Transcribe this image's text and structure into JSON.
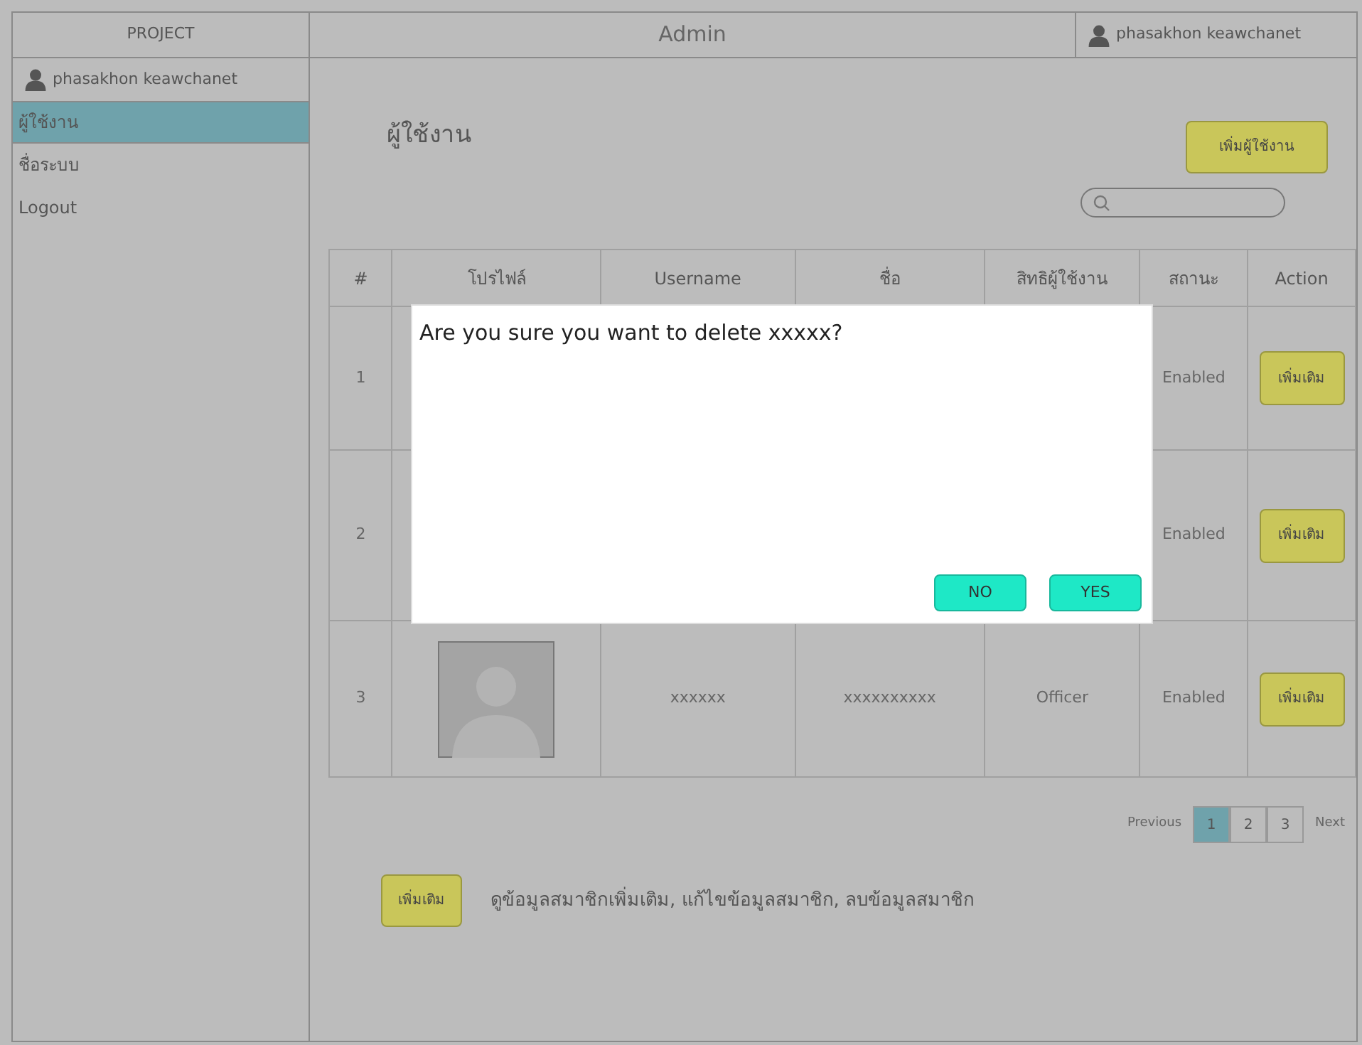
{
  "sidebar": {
    "brand": "PROJECT",
    "user": "phasakhon keawchanet",
    "items": [
      {
        "label": "ผู้ใช้งาน",
        "selected": true
      },
      {
        "label": "ชื่อระบบ",
        "selected": false
      },
      {
        "label": "Logout",
        "selected": false
      }
    ]
  },
  "header": {
    "title": "Admin",
    "user": "phasakhon keawchanet"
  },
  "page": {
    "title": "ผู้ใช้งาน",
    "add_button": "เพิ่มผู้ใช้งาน"
  },
  "table": {
    "columns": [
      "#",
      "โปรไฟล์",
      "Username",
      "ชื่อ",
      "สิทธิผู้ใช้งาน",
      "สถานะ",
      "Action"
    ],
    "rows": [
      {
        "number": "1",
        "status": "Enabled",
        "action": "เพิ่มเติม"
      },
      {
        "number": "2",
        "status": "Enabled",
        "action": "เพิ่มเติม"
      },
      {
        "number": "3",
        "photo": true,
        "username": "xxxxxx",
        "name": "xxxxxxxxxx",
        "role": "Officer",
        "status": "Enabled",
        "action": "เพิ่มเติม"
      }
    ]
  },
  "pagination": {
    "previous": "Previous",
    "pages": [
      {
        "label": "1",
        "selected": true
      },
      {
        "label": "2",
        "selected": false
      },
      {
        "label": "3",
        "selected": false
      }
    ],
    "next": "Next"
  },
  "legend": {
    "button": "เพิ่มเติม",
    "text": "ดูข้อมูลสมาชิกเพิ่มเติม, แก้ไขข้อมูลสมาชิก, ลบข้อมูลสมาชิก"
  },
  "dialog": {
    "message": "Are you sure you want to delete xxxxx?",
    "buttons": [
      "NO",
      "YES"
    ]
  }
}
